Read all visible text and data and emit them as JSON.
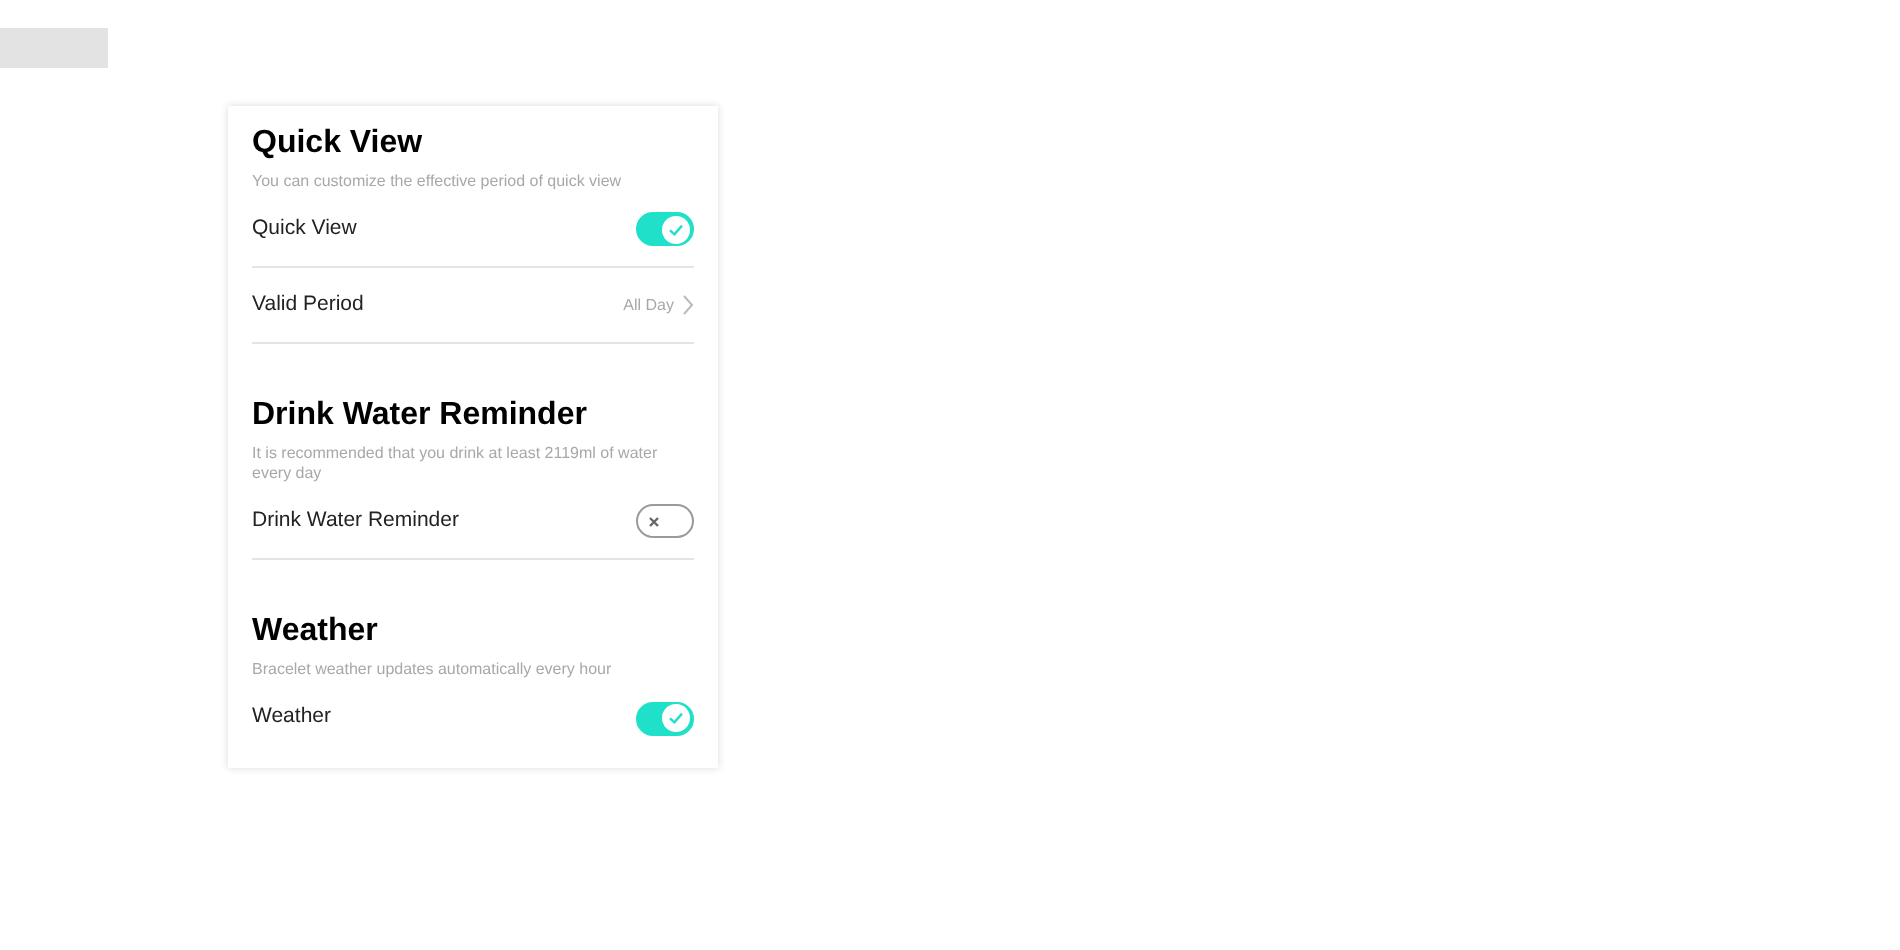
{
  "sections": [
    {
      "title": "Quick View",
      "description": "You can customize the effective period of quick view",
      "rows": [
        {
          "kind": "toggle",
          "label": "Quick View",
          "on": true
        },
        {
          "kind": "link",
          "label": "Valid Period",
          "value": "All Day"
        }
      ]
    },
    {
      "title": "Drink Water Reminder",
      "description": "It is recommended that you drink at least 2119ml of water every day",
      "rows": [
        {
          "kind": "toggle",
          "label": "Drink Water Reminder",
          "on": false
        }
      ]
    },
    {
      "title": "Weather",
      "description": "Bracelet weather updates automatically every hour",
      "rows": [
        {
          "kind": "toggle",
          "label": "Weather",
          "on": true
        }
      ]
    }
  ]
}
